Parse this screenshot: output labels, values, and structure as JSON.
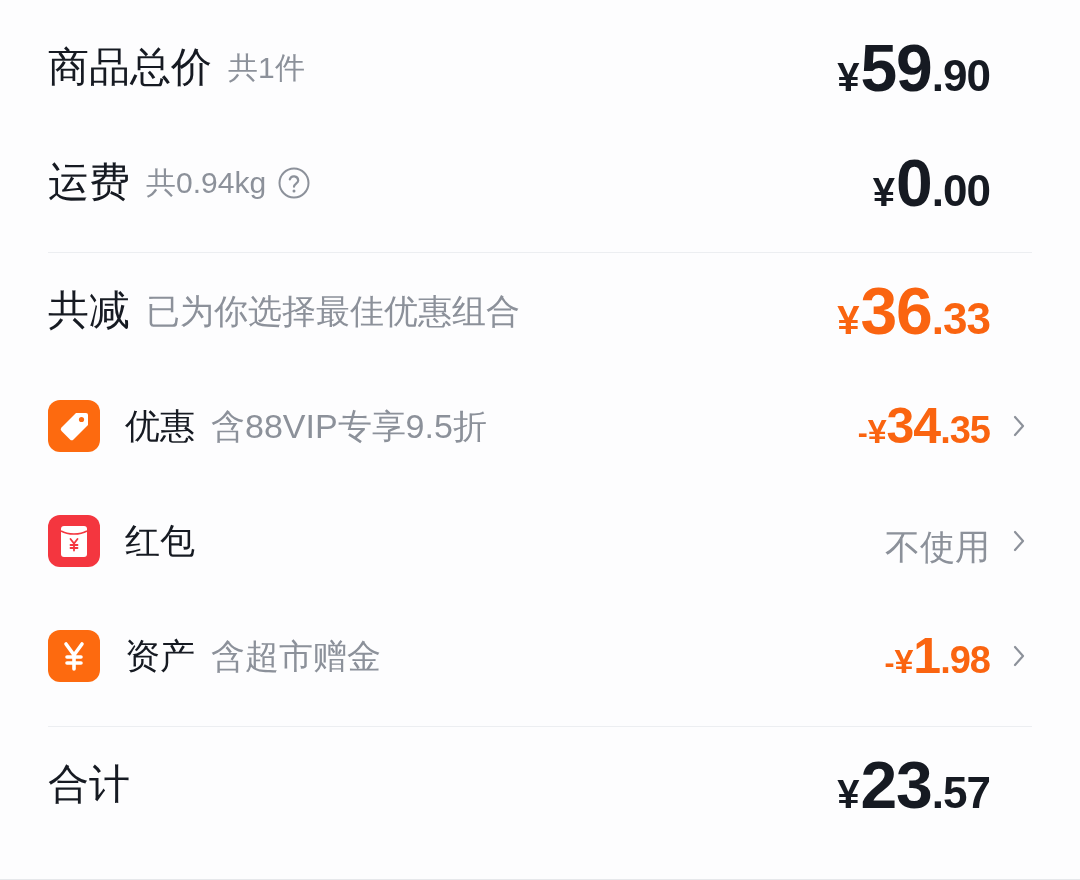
{
  "summary": [
    {
      "label": "商品总价",
      "note": "共1件",
      "help": false,
      "amount": {
        "currency": "¥",
        "integer": "59",
        "decimal": ".90"
      }
    },
    {
      "label": "运费",
      "note": "共0.94kg",
      "help": true,
      "amount": {
        "currency": "¥",
        "integer": "0",
        "decimal": ".00"
      }
    }
  ],
  "reduction": {
    "label": "共减",
    "note": "已为你选择最佳优惠组合",
    "amount": {
      "currency": "¥",
      "integer": "36",
      "decimal": ".33"
    }
  },
  "benefits": [
    {
      "kind": "coupon",
      "label": "优惠",
      "note": "含88VIP专享9.5折",
      "amount": {
        "sign": "-",
        "currency": "¥",
        "integer": "34",
        "decimal": ".35"
      }
    },
    {
      "kind": "redpacket",
      "label": "红包",
      "value": "不使用"
    },
    {
      "kind": "assets",
      "label": "资产",
      "note": "含超市赠金",
      "amount": {
        "sign": "-",
        "currency": "¥",
        "integer": "1",
        "decimal": ".98"
      }
    }
  ],
  "total": {
    "label": "合计",
    "amount": {
      "currency": "¥",
      "integer": "23",
      "decimal": ".57"
    }
  }
}
